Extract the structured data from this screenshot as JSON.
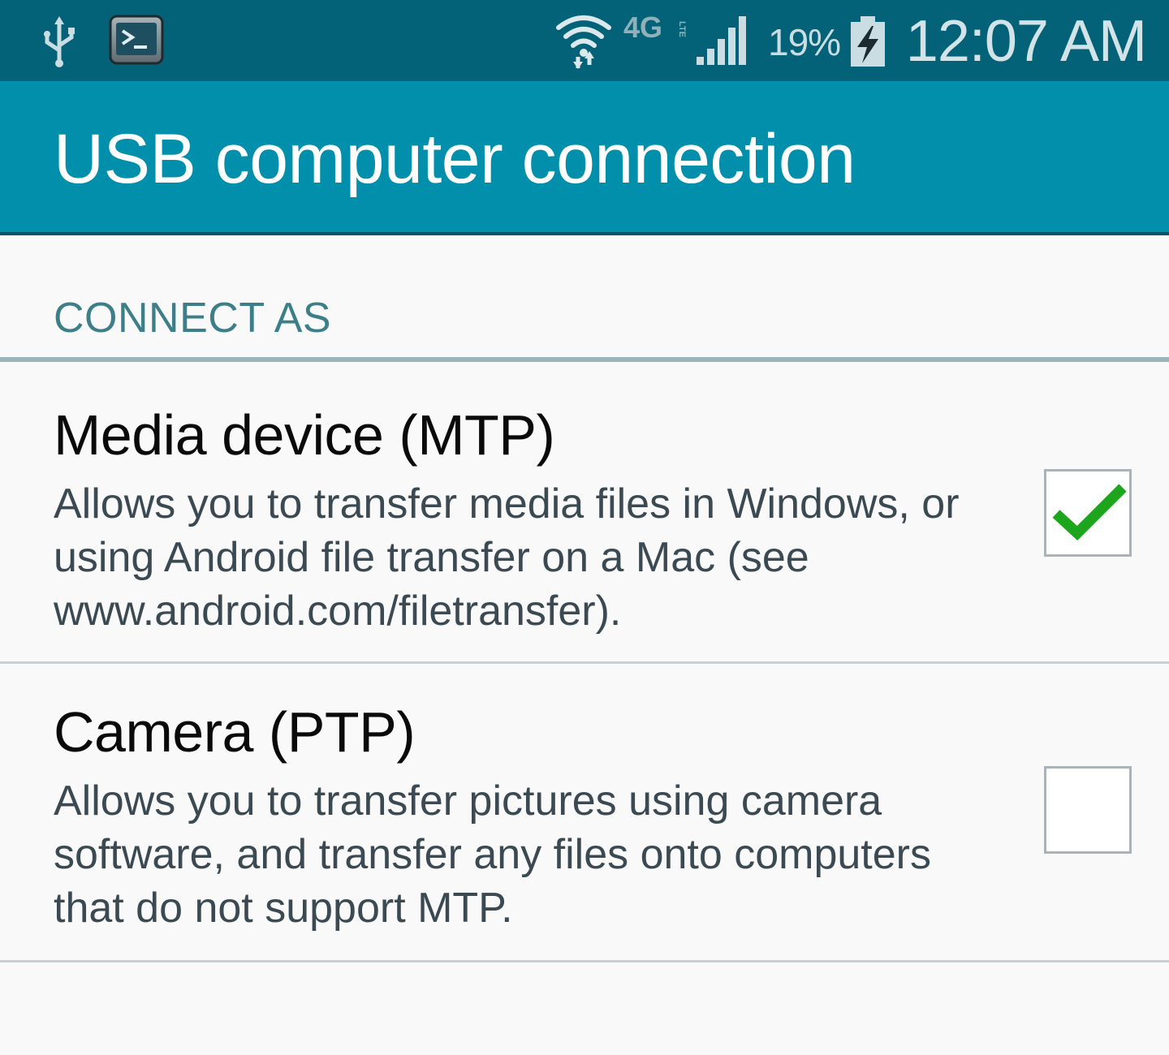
{
  "status_bar": {
    "network": "4G",
    "network_sub": "LTE",
    "battery_percent": "19%",
    "time": "12:07 AM",
    "icons": [
      "usb-icon",
      "terminal-icon",
      "wifi-icon",
      "network-4g-lte-icon",
      "signal-icon",
      "battery-charging-icon"
    ]
  },
  "action_bar": {
    "title": "USB computer connection"
  },
  "section": {
    "header": "CONNECT AS"
  },
  "options": [
    {
      "title": "Media device (MTP)",
      "description": "Allows you to transfer media files in Windows, or using Android file transfer on a Mac (see www.android.com/filetransfer).",
      "checked": true
    },
    {
      "title": "Camera (PTP)",
      "description": "Allows you to transfer pictures using camera software, and transfer any files onto computers that do not support MTP.",
      "checked": false
    }
  ],
  "colors": {
    "status_bar": "#046278",
    "action_bar": "#028fab",
    "accent_text": "#3d7f89",
    "check": "#1ea51e"
  }
}
